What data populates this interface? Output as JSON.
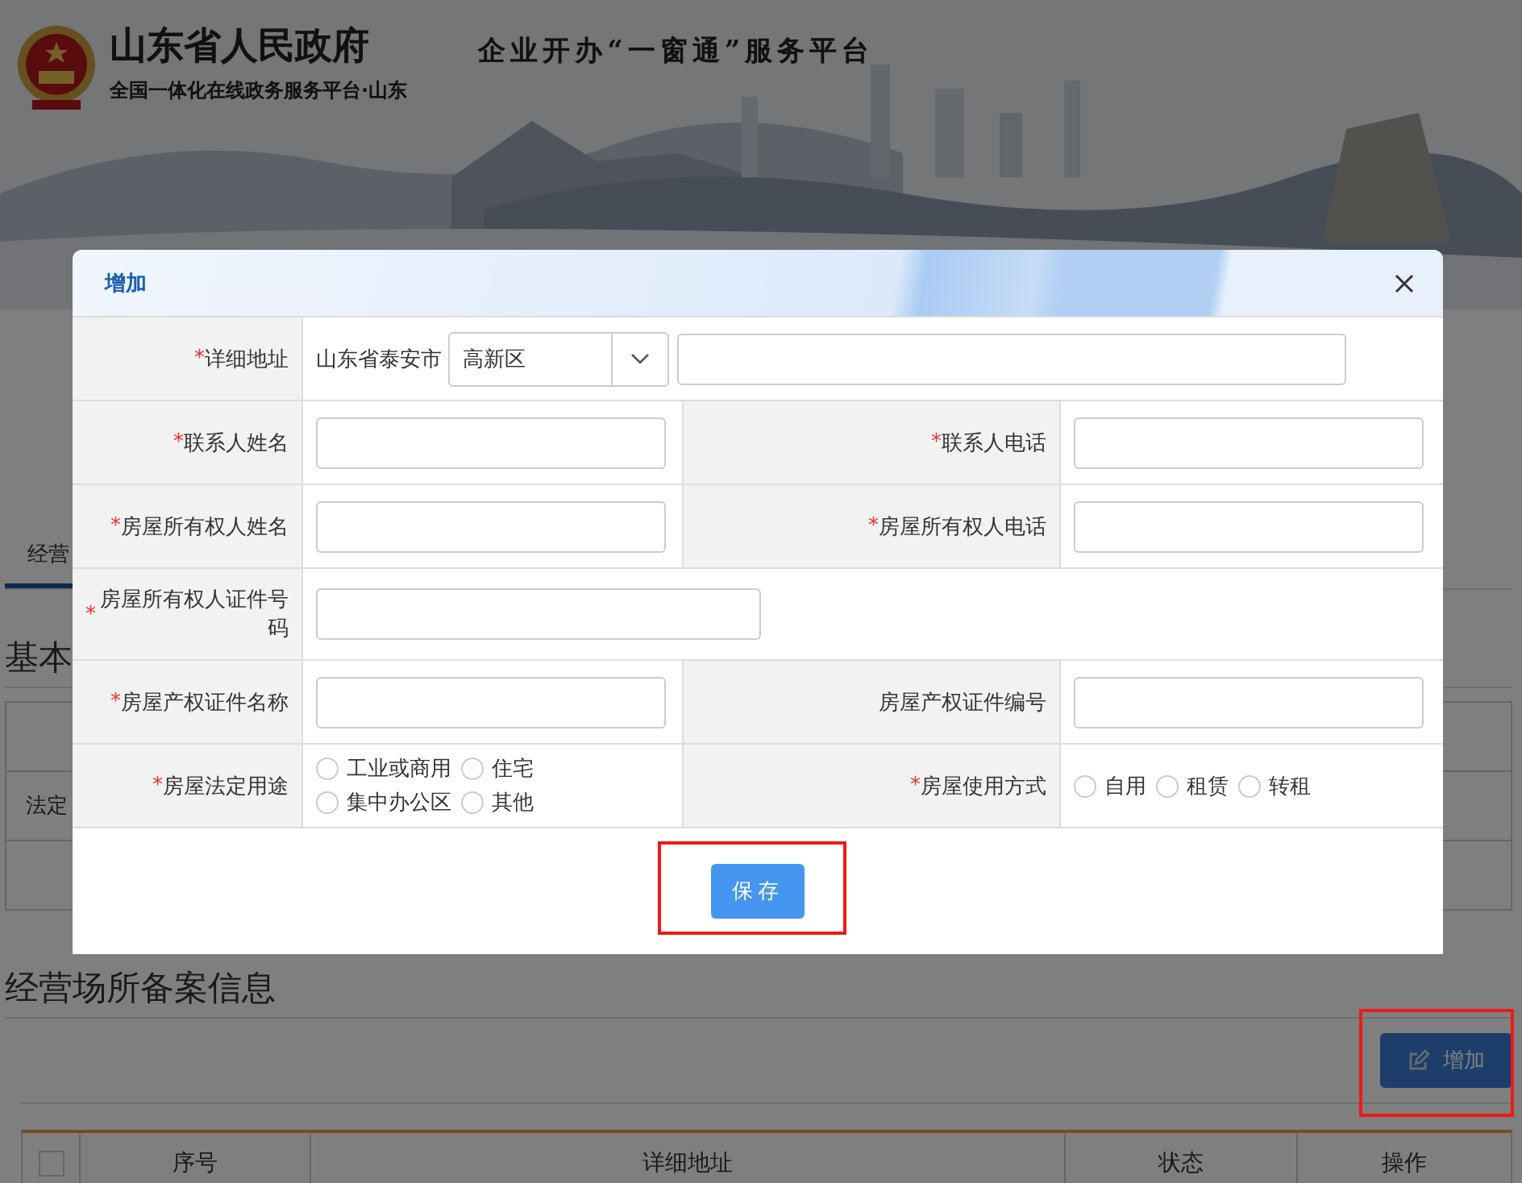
{
  "header": {
    "title": "山东省人民政府",
    "subtitle": "全国一体化在线政务服务平台·山东",
    "platform_title": "企业开办“一窗通”服务平台"
  },
  "page": {
    "tabs": [
      {
        "label": "经营",
        "selected": true
      }
    ],
    "section_title": "基本",
    "table_cell": "法定",
    "records_title": "经营场所备案信息",
    "add_button": "增加",
    "select_all": {
      "checked": false
    },
    "columns": [
      "序号",
      "详细地址",
      "状态",
      "操作"
    ]
  },
  "dialog": {
    "title": "增加",
    "rows": [
      [
        {
          "kind": "address",
          "label": "详细地址",
          "required_mark": "*",
          "prefix": "山东省泰安市",
          "select_value": "高新区"
        }
      ],
      [
        {
          "kind": "text",
          "label": "联系人姓名",
          "required_mark": "*"
        },
        {
          "kind": "text",
          "label": "联系人电话",
          "required_mark": "*"
        }
      ],
      [
        {
          "kind": "text",
          "label": "房屋所有权人姓名",
          "required_mark": "*"
        },
        {
          "kind": "text",
          "label": "房屋所有权人电话",
          "required_mark": "*"
        }
      ],
      [
        {
          "kind": "wide",
          "label": "房屋所有权人证件号码",
          "required_mark": "*"
        }
      ],
      [
        {
          "kind": "text",
          "label": "房屋产权证件名称",
          "required_mark": "*"
        },
        {
          "kind": "text",
          "label": "房屋产权证件编号"
        }
      ],
      [
        {
          "kind": "radio",
          "label": "房屋法定用途",
          "required_mark": "*",
          "options": [
            {
              "label": "工业或商用",
              "selected": false
            },
            {
              "label": "住宅",
              "selected": false
            },
            {
              "label": "集中办公区",
              "selected": false
            },
            {
              "label": "其他",
              "selected": false
            }
          ]
        },
        {
          "kind": "radio",
          "label": "房屋使用方式",
          "required_mark": "*",
          "options": [
            {
              "label": "自用",
              "selected": false
            },
            {
              "label": "租赁",
              "selected": false
            },
            {
              "label": "转租",
              "selected": false
            }
          ]
        }
      ]
    ],
    "save_button": "保存"
  }
}
